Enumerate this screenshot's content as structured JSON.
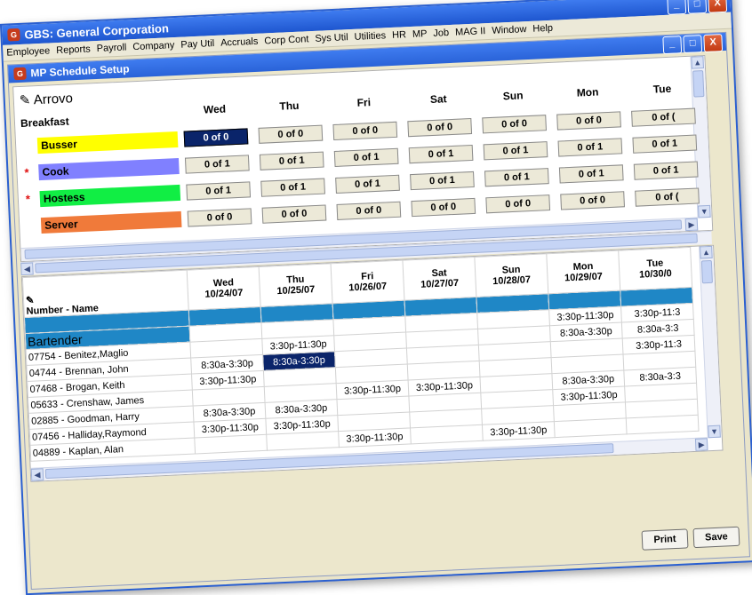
{
  "app": {
    "title": "GBS: General Corporation",
    "logo_text": "G",
    "menu": [
      "Employee",
      "Reports",
      "Payroll",
      "Company",
      "Pay Util",
      "Accruals",
      "Corp Cont",
      "Sys Util",
      "Utilities",
      "HR",
      "MP",
      "Job",
      "MAG II",
      "Window",
      "Help"
    ]
  },
  "window": {
    "minimize": "_",
    "maximize": "□",
    "close": "X"
  },
  "inner": {
    "title": "MP Schedule Setup"
  },
  "top": {
    "location": "Arrovo",
    "meal": "Breakfast",
    "days": [
      "Wed",
      "Thu",
      "Fri",
      "Sat",
      "Sun",
      "Mon",
      "Tue"
    ],
    "roles": [
      {
        "name": "Busser",
        "color": "#ffff00",
        "required": false,
        "counts": [
          "0 of 0",
          "0 of 0",
          "0 of 0",
          "0 of 0",
          "0 of 0",
          "0 of 0",
          "0 of ("
        ]
      },
      {
        "name": "Cook",
        "color": "#8080ff",
        "required": true,
        "counts": [
          "0 of 1",
          "0 of 1",
          "0 of 1",
          "0 of 1",
          "0 of 1",
          "0 of 1",
          "0 of 1"
        ]
      },
      {
        "name": "Hostess",
        "color": "#11ee44",
        "required": true,
        "counts": [
          "0 of 1",
          "0 of 1",
          "0 of 1",
          "0 of 1",
          "0 of 1",
          "0 of 1",
          "0 of 1"
        ]
      },
      {
        "name": "Server",
        "color": "#f07a3a",
        "required": false,
        "counts": [
          "0 of 0",
          "0 of 0",
          "0 of 0",
          "0 of 0",
          "0 of 0",
          "0 of 0",
          "0 of ("
        ]
      }
    ],
    "selected_count": "Busser/Wed",
    "required_mark": "*"
  },
  "grid": {
    "name_header": "Number - Name",
    "days": [
      {
        "day": "Wed",
        "date": "10/24/07"
      },
      {
        "day": "Thu",
        "date": "10/25/07"
      },
      {
        "day": "Fri",
        "date": "10/26/07"
      },
      {
        "day": "Sat",
        "date": "10/27/07"
      },
      {
        "day": "Sun",
        "date": "10/28/07"
      },
      {
        "day": "Mon",
        "date": "10/29/07"
      },
      {
        "day": "Tue",
        "date": "10/30/0"
      }
    ],
    "group": "Bartender",
    "group_row": [
      "",
      "",
      "",
      "",
      "",
      "3:30p-11:30p",
      "3:30p-11:3"
    ],
    "rows": [
      {
        "name": "07754 - Benitez,Maglio",
        "shifts": [
          "",
          "3:30p-11:30p",
          "",
          "",
          "",
          "8:30a-3:30p",
          "8:30a-3:3"
        ]
      },
      {
        "name": "04744 - Brennan, John",
        "shifts": [
          "8:30a-3:30p",
          "8:30a-3:30p",
          "",
          "",
          "",
          "",
          "3:30p-11:3"
        ]
      },
      {
        "name": "07468 - Brogan, Keith",
        "shifts": [
          "3:30p-11:30p",
          "",
          "",
          "",
          "",
          "",
          ""
        ]
      },
      {
        "name": "05633 - Crenshaw, James",
        "shifts": [
          "",
          "",
          "3:30p-11:30p",
          "3:30p-11:30p",
          "",
          "8:30a-3:30p",
          "8:30a-3:3"
        ]
      },
      {
        "name": "02885 - Goodman, Harry",
        "shifts": [
          "8:30a-3:30p",
          "8:30a-3:30p",
          "",
          "",
          "",
          "3:30p-11:30p",
          ""
        ]
      },
      {
        "name": "07456 - Halliday,Raymond",
        "shifts": [
          "3:30p-11:30p",
          "3:30p-11:30p",
          "",
          "",
          "",
          "",
          ""
        ]
      },
      {
        "name": "04889 - Kaplan, Alan",
        "shifts": [
          "",
          "",
          "3:30p-11:30p",
          "",
          "3:30p-11:30p",
          "",
          ""
        ]
      }
    ],
    "selected_cell": "04744 - Brennan, John / Thu"
  },
  "buttons": {
    "print": "Print",
    "save": "Save"
  },
  "colors": {
    "title_bar": "#2a63d8",
    "group_band": "#1f87c6",
    "selection": "#0a246a",
    "required_mark": "#e01010"
  }
}
